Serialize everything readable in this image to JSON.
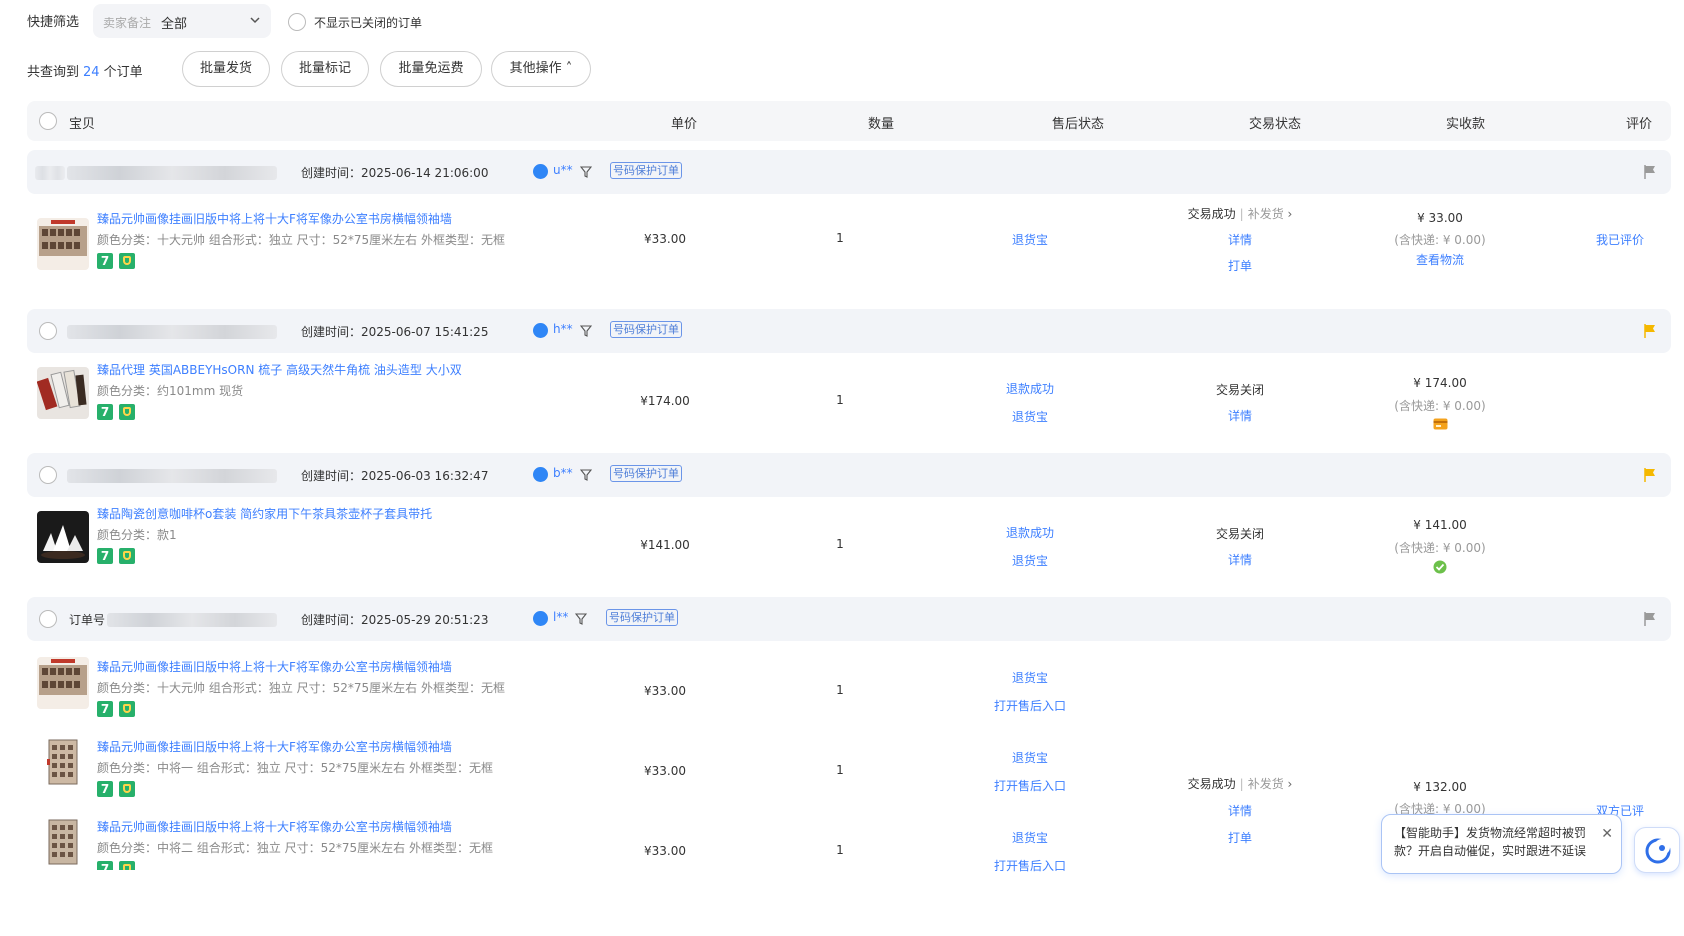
{
  "filter": {
    "label": "快捷筛选",
    "select_prefix": "卖家备注",
    "select_value": "全部",
    "hide_closed_label": "不显示已关闭的订单"
  },
  "batch": {
    "count_prefix": "共查询到",
    "count": "24",
    "count_suffix": "个订单",
    "buttons": [
      "批量发货",
      "批量标记",
      "批量免运费",
      "其他操作 ˄"
    ]
  },
  "columns": [
    "宝贝",
    "单价",
    "数量",
    "售后状态",
    "交易状态",
    "实收款",
    "评价"
  ],
  "orders": [
    {
      "created": "创建时间：2025-06-14 21:06:00",
      "buyer": "u**",
      "tag": "号码保护订单",
      "items": [
        {
          "title": "臻品元帅画像挂画旧版中将上将十大F将军像办公室书房横幅领袖墙",
          "sku": "颜色分类：十大元帅   组合形式：独立   尺寸：52*75厘米左右   外框类型：无框",
          "price": "¥33.00",
          "qty": "1",
          "aftersale": [
            "退货宝"
          ]
        }
      ],
      "trade_status": "交易成功",
      "trade_extra": "补发货",
      "trade_links": [
        "详情",
        "打单"
      ],
      "amount": "¥ 33.00",
      "shipping": "(含快递: ¥ 0.00)",
      "amount_link": "查看物流",
      "review": "我已评价"
    },
    {
      "created": "创建时间：2025-06-07 15:41:25",
      "buyer": "h**",
      "tag": "号码保护订单",
      "items": [
        {
          "title": "臻品代理 英国ABBEYHsORN 梳子 高级天然牛角梳 油头造型 大小双",
          "sku": "颜色分类：约101mm 现货",
          "price": "¥174.00",
          "qty": "1",
          "aftersale": [
            "退款成功",
            "退货宝"
          ]
        }
      ],
      "trade_status": "交易关闭",
      "trade_links": [
        "详情"
      ],
      "amount": "¥ 174.00",
      "shipping": "(含快递: ¥ 0.00)"
    },
    {
      "created": "创建时间：2025-06-03 16:32:47",
      "buyer": "b**",
      "tag": "号码保护订单",
      "items": [
        {
          "title": "臻品陶瓷创意咖啡杯o套装 简约家用下午茶具茶壶杯子套具带托",
          "sku": "颜色分类：款1",
          "price": "¥141.00",
          "qty": "1",
          "aftersale": [
            "退款成功",
            "退货宝"
          ]
        }
      ],
      "trade_status": "交易关闭",
      "trade_links": [
        "详情"
      ],
      "amount": "¥ 141.00",
      "shipping": "(含快递: ¥ 0.00)"
    },
    {
      "created": "创建时间：2025-05-29 20:51:23",
      "buyer": "l**",
      "tag": "号码保护订单",
      "head_prefix": "订单号",
      "items": [
        {
          "title": "臻品元帅画像挂画旧版中将上将十大F将军像办公室书房横幅领袖墙",
          "sku": "颜色分类：十大元帅   组合形式：独立   尺寸：52*75厘米左右   外框类型：无框",
          "price": "¥33.00",
          "qty": "1",
          "aftersale": [
            "退货宝",
            "打开售后入口"
          ]
        },
        {
          "title": "臻品元帅画像挂画旧版中将上将十大F将军像办公室书房横幅领袖墙",
          "sku": "颜色分类：中将一   组合形式：独立   尺寸：52*75厘米左右   外框类型：无框",
          "price": "¥33.00",
          "qty": "1",
          "aftersale": [
            "退货宝",
            "打开售后入口"
          ]
        },
        {
          "title": "臻品元帅画像挂画旧版中将上将十大F将军像办公室书房横幅领袖墙",
          "sku": "颜色分类：中将二   组合形式：独立   尺寸：52*75厘米左右   外框类型：无框",
          "price": "¥33.00",
          "qty": "1",
          "aftersale": [
            "退货宝",
            "打开售后入口"
          ]
        }
      ],
      "trade_status": "交易成功",
      "trade_extra": "补发货",
      "trade_links": [
        "详情",
        "打单"
      ],
      "amount": "¥ 132.00",
      "shipping": "(含快递: ¥ 0.00)",
      "review": "双方已评"
    }
  ],
  "assistant": {
    "text": "【智能助手】发货物流经常超时被罚款？开启自动催促，实时跟进不延误",
    "close": "✕"
  },
  "colors": {
    "link": "#3d7fff",
    "flag_active": "#f5b800",
    "flag_idle": "#9a9a9a",
    "badge_green": "#27b06b"
  }
}
